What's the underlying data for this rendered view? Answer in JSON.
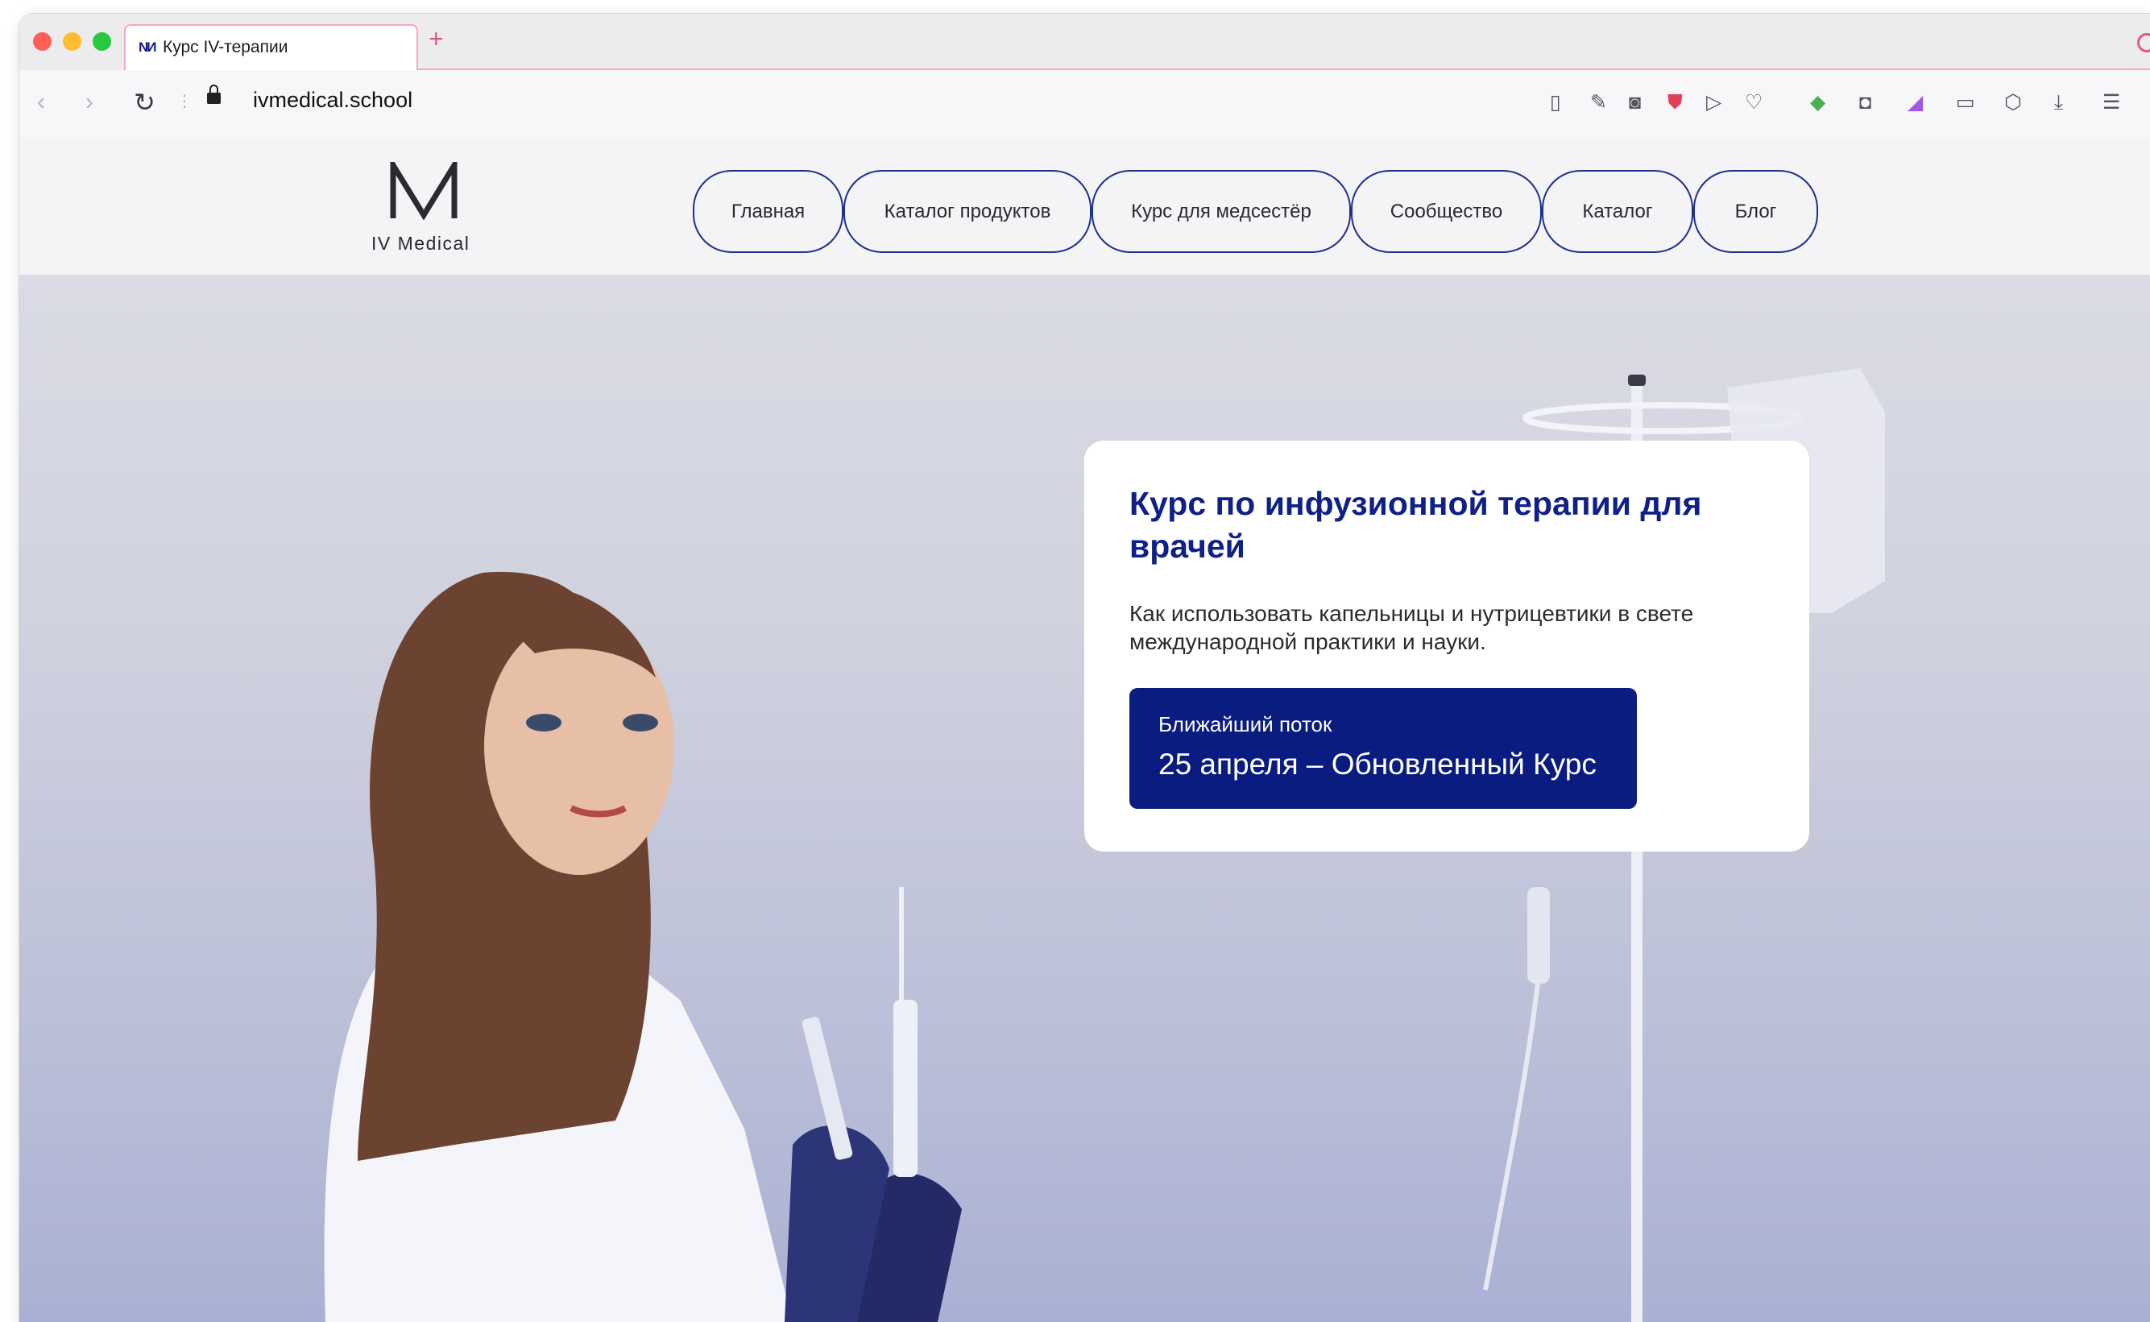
{
  "browser": {
    "tab_title": "Курс IV-терапии",
    "tab_favicon": "NИ",
    "new_tab_symbol": "+",
    "url": "ivmedical.school",
    "toolbar_icons": [
      "reader-icon",
      "edit-icon",
      "camera-icon",
      "shield-icon",
      "send-icon",
      "heart-icon",
      "gem-icon",
      "screenshot-icon",
      "palette-icon",
      "mouse-icon",
      "cube-icon",
      "download-icon",
      "menu-icon"
    ]
  },
  "site": {
    "logo_text": "IV Medical",
    "nav": [
      {
        "label": "Главная"
      },
      {
        "label": "Каталог продуктов"
      },
      {
        "label": "Курс для медсестёр"
      },
      {
        "label": "Сообщество"
      },
      {
        "label": "Каталог"
      },
      {
        "label": "Блог"
      }
    ]
  },
  "hero": {
    "title": "Курс по инфузионной терапии для врачей",
    "subtitle": "Как использовать капельницы и нутрицевтики в свете международной практики и науки.",
    "cta_label": "Ближайший поток",
    "cta_date": "25 апреля – Обновленный Курс"
  },
  "colors": {
    "brand_navy": "#0b1c80",
    "title_blue": "#0f2189",
    "nav_border": "#1e2f8e",
    "tab_accent": "#f4a8bb"
  }
}
